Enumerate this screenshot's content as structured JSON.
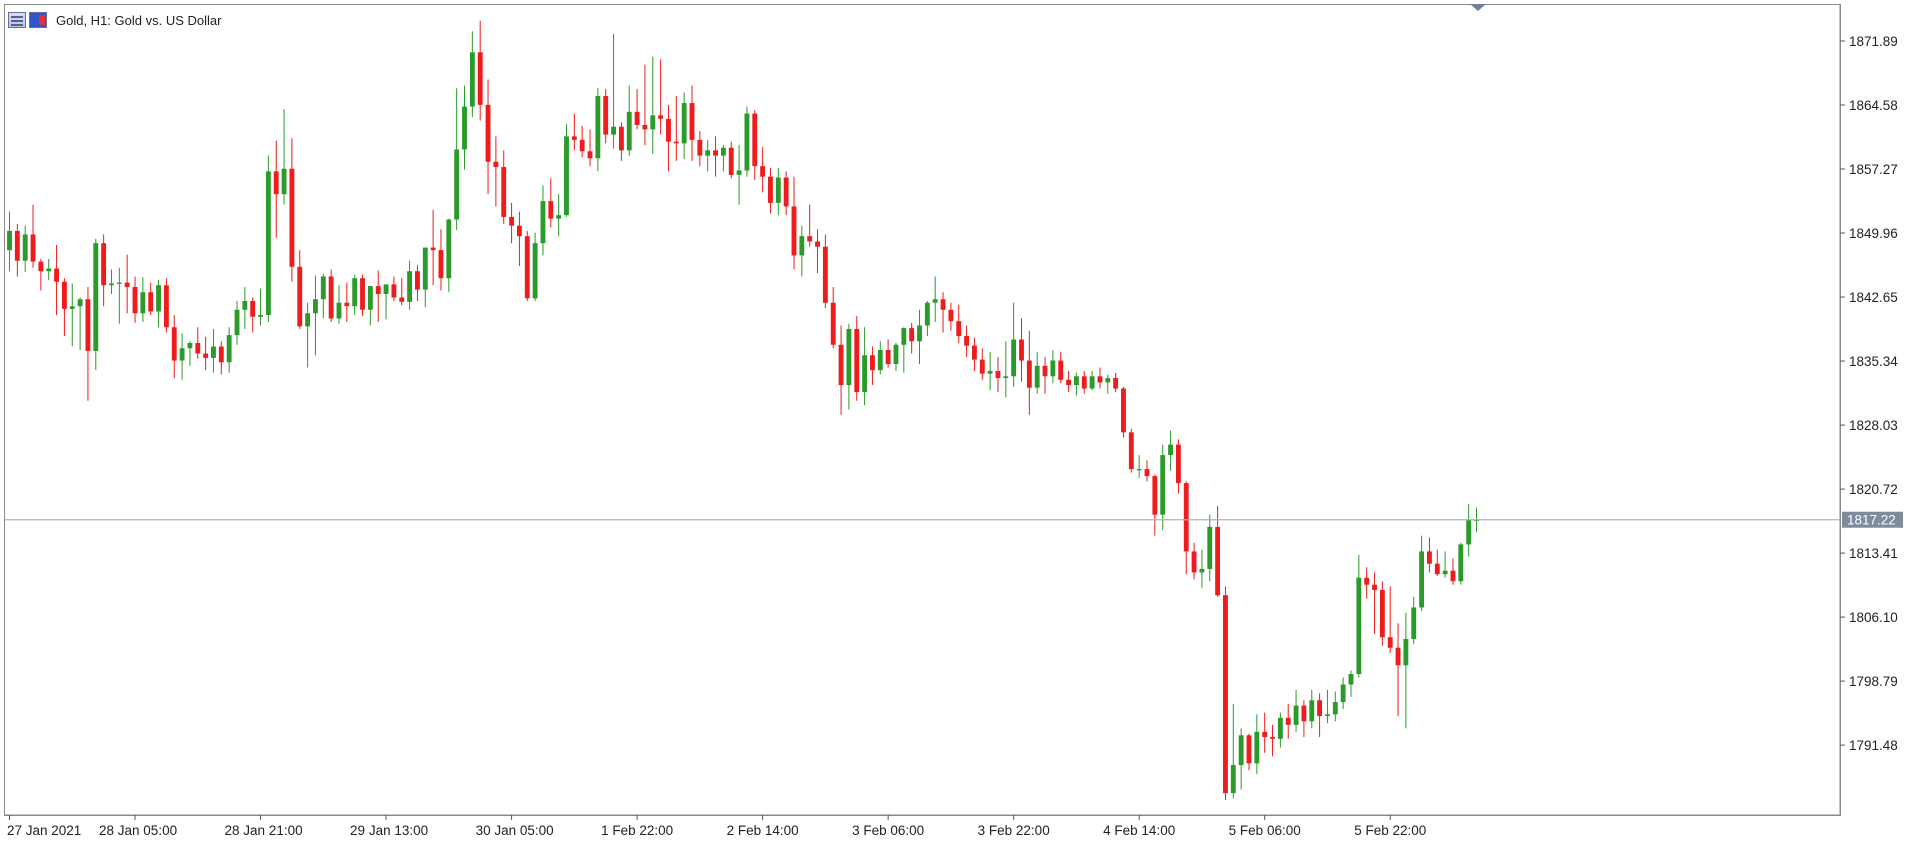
{
  "window": {
    "title": "Gold, H1:  Gold vs. US Dollar"
  },
  "icons": {
    "left": "chart-window-icon",
    "right": "indicator-icon"
  },
  "colors": {
    "bull": "#2a9a2a",
    "bear": "#ee1c1c",
    "wick_bull": "#2a9a2a",
    "wick_bear": "#ee1c1c",
    "grid_bid_line": "#a7b4c3",
    "bid_label_bg": "#7d8b9b",
    "bid_label_text": "#ffffff"
  },
  "chart_data": {
    "type": "candlestick",
    "symbol": "Gold",
    "timeframe": "H1",
    "title": "Gold, H1:  Gold vs. US Dollar",
    "y_ticks": [
      "1871.89",
      "1864.58",
      "1857.27",
      "1849.96",
      "1842.65",
      "1835.34",
      "1828.03",
      "1820.72",
      "1813.41",
      "1806.10",
      "1798.79",
      "1791.48"
    ],
    "x_ticks": [
      "27 Jan 2021",
      "28 Jan 05:00",
      "28 Jan 21:00",
      "29 Jan 13:00",
      "30 Jan 05:00",
      "1 Feb 22:00",
      "2 Feb 14:00",
      "3 Feb 06:00",
      "3 Feb 22:00",
      "4 Feb 14:00",
      "5 Feb 06:00",
      "5 Feb 22:00"
    ],
    "ylim": [
      1783.5,
      1876.0
    ],
    "current_price": "1817.22",
    "ohlc": [
      [
        1848.0,
        1852.4,
        1845.6,
        1850.2
      ],
      [
        1850.2,
        1851.0,
        1845.0,
        1846.8
      ],
      [
        1846.8,
        1850.8,
        1845.5,
        1849.8
      ],
      [
        1849.8,
        1853.2,
        1846.0,
        1846.7
      ],
      [
        1846.7,
        1847.0,
        1843.4,
        1845.6
      ],
      [
        1845.6,
        1847.0,
        1844.6,
        1845.9
      ],
      [
        1845.9,
        1848.6,
        1840.6,
        1844.4
      ],
      [
        1844.4,
        1844.8,
        1838.2,
        1841.3
      ],
      [
        1841.3,
        1844.2,
        1837.0,
        1841.6
      ],
      [
        1841.6,
        1842.6,
        1836.6,
        1842.4
      ],
      [
        1842.4,
        1843.8,
        1830.8,
        1836.5
      ],
      [
        1836.5,
        1849.3,
        1834.3,
        1848.8
      ],
      [
        1848.8,
        1849.8,
        1841.6,
        1844.0
      ],
      [
        1844.0,
        1845.8,
        1843.0,
        1844.2
      ],
      [
        1844.2,
        1846.0,
        1839.6,
        1844.3
      ],
      [
        1844.3,
        1847.5,
        1840.8,
        1843.8
      ],
      [
        1843.8,
        1845.0,
        1839.7,
        1840.8
      ],
      [
        1840.8,
        1844.9,
        1839.8,
        1843.2
      ],
      [
        1843.2,
        1844.3,
        1840.6,
        1841.0
      ],
      [
        1841.0,
        1844.6,
        1839.2,
        1844.0
      ],
      [
        1844.0,
        1844.8,
        1838.6,
        1839.2
      ],
      [
        1839.2,
        1840.6,
        1833.4,
        1835.4
      ],
      [
        1835.4,
        1838.5,
        1833.2,
        1836.8
      ],
      [
        1836.8,
        1837.6,
        1834.8,
        1837.4
      ],
      [
        1837.4,
        1839.2,
        1835.6,
        1836.2
      ],
      [
        1836.2,
        1838.1,
        1834.3,
        1835.7
      ],
      [
        1835.7,
        1839.0,
        1834.0,
        1837.0
      ],
      [
        1837.0,
        1837.6,
        1833.8,
        1835.2
      ],
      [
        1835.2,
        1839.2,
        1834.0,
        1838.3
      ],
      [
        1838.3,
        1842.2,
        1837.2,
        1841.2
      ],
      [
        1841.2,
        1843.8,
        1839.0,
        1842.2
      ],
      [
        1842.2,
        1842.6,
        1838.6,
        1840.4
      ],
      [
        1840.4,
        1843.6,
        1839.4,
        1840.6
      ],
      [
        1840.6,
        1858.8,
        1839.8,
        1857.0
      ],
      [
        1857.0,
        1860.5,
        1849.4,
        1854.4
      ],
      [
        1854.4,
        1864.1,
        1853.2,
        1857.3
      ],
      [
        1857.3,
        1860.8,
        1844.4,
        1846.1
      ],
      [
        1846.1,
        1848.0,
        1839.0,
        1839.3
      ],
      [
        1839.3,
        1842.0,
        1834.6,
        1840.8
      ],
      [
        1840.8,
        1845.1,
        1836.0,
        1842.4
      ],
      [
        1842.4,
        1845.3,
        1840.2,
        1845.0
      ],
      [
        1845.0,
        1845.8,
        1839.8,
        1840.2
      ],
      [
        1840.2,
        1844.0,
        1839.6,
        1842.0
      ],
      [
        1842.0,
        1844.3,
        1839.8,
        1841.6
      ],
      [
        1841.6,
        1845.2,
        1840.6,
        1844.8
      ],
      [
        1844.8,
        1845.2,
        1840.5,
        1841.2
      ],
      [
        1841.2,
        1843.4,
        1839.4,
        1843.9
      ],
      [
        1843.9,
        1845.7,
        1839.8,
        1843.0
      ],
      [
        1843.0,
        1844.0,
        1840.1,
        1844.1
      ],
      [
        1844.1,
        1845.0,
        1842.2,
        1842.6
      ],
      [
        1842.6,
        1844.8,
        1841.7,
        1842.1
      ],
      [
        1842.1,
        1846.8,
        1841.2,
        1845.6
      ],
      [
        1845.6,
        1846.3,
        1842.2,
        1843.5
      ],
      [
        1843.5,
        1848.3,
        1841.5,
        1848.3
      ],
      [
        1848.3,
        1852.6,
        1844.0,
        1848.0
      ],
      [
        1848.0,
        1850.4,
        1843.4,
        1844.8
      ],
      [
        1844.8,
        1851.6,
        1843.2,
        1851.5
      ],
      [
        1851.5,
        1866.5,
        1850.3,
        1859.5
      ],
      [
        1859.5,
        1866.8,
        1857.2,
        1864.4
      ],
      [
        1864.4,
        1873.0,
        1863.2,
        1870.6
      ],
      [
        1870.6,
        1874.2,
        1862.8,
        1864.6
      ],
      [
        1864.6,
        1867.5,
        1854.4,
        1858.1
      ],
      [
        1858.1,
        1861.0,
        1853.0,
        1857.5
      ],
      [
        1857.5,
        1859.4,
        1851.0,
        1851.8
      ],
      [
        1851.8,
        1853.4,
        1848.8,
        1850.8
      ],
      [
        1850.8,
        1852.4,
        1846.2,
        1849.6
      ],
      [
        1849.6,
        1850.2,
        1842.2,
        1842.5
      ],
      [
        1842.5,
        1850.0,
        1842.2,
        1848.8
      ],
      [
        1848.8,
        1855.4,
        1847.4,
        1853.6
      ],
      [
        1853.6,
        1856.2,
        1850.6,
        1851.6
      ],
      [
        1851.6,
        1854.4,
        1849.6,
        1852.0
      ],
      [
        1852.0,
        1862.4,
        1851.8,
        1861.0
      ],
      [
        1861.0,
        1863.6,
        1859.4,
        1860.6
      ],
      [
        1860.6,
        1862.2,
        1858.6,
        1859.3
      ],
      [
        1859.3,
        1861.8,
        1857.6,
        1858.5
      ],
      [
        1858.5,
        1866.5,
        1857.0,
        1865.6
      ],
      [
        1865.6,
        1866.4,
        1860.2,
        1861.2
      ],
      [
        1861.2,
        1872.7,
        1859.6,
        1862.1
      ],
      [
        1862.1,
        1862.6,
        1858.2,
        1859.4
      ],
      [
        1859.4,
        1866.8,
        1858.8,
        1863.8
      ],
      [
        1863.8,
        1866.4,
        1861.8,
        1862.3
      ],
      [
        1862.3,
        1869.2,
        1860.0,
        1861.8
      ],
      [
        1861.8,
        1870.1,
        1859.0,
        1863.4
      ],
      [
        1863.4,
        1869.8,
        1861.2,
        1863.0
      ],
      [
        1863.0,
        1864.6,
        1857.0,
        1860.4
      ],
      [
        1860.4,
        1865.6,
        1858.2,
        1860.2
      ],
      [
        1860.2,
        1866.0,
        1858.4,
        1864.8
      ],
      [
        1864.8,
        1866.8,
        1858.2,
        1860.6
      ],
      [
        1860.6,
        1861.6,
        1857.6,
        1858.8
      ],
      [
        1858.8,
        1860.6,
        1857.0,
        1859.4
      ],
      [
        1859.4,
        1861.0,
        1856.4,
        1858.8
      ],
      [
        1858.8,
        1860.0,
        1857.0,
        1859.7
      ],
      [
        1859.7,
        1860.4,
        1856.2,
        1856.6
      ],
      [
        1856.6,
        1860.0,
        1853.2,
        1857.1
      ],
      [
        1857.1,
        1864.4,
        1856.4,
        1863.6
      ],
      [
        1863.6,
        1864.0,
        1856.0,
        1857.6
      ],
      [
        1857.6,
        1859.8,
        1854.6,
        1856.4
      ],
      [
        1856.4,
        1857.4,
        1852.2,
        1853.4
      ],
      [
        1853.4,
        1857.4,
        1852.0,
        1856.3
      ],
      [
        1856.3,
        1857.0,
        1852.0,
        1853.0
      ],
      [
        1853.0,
        1856.4,
        1845.8,
        1847.4
      ],
      [
        1847.4,
        1850.8,
        1845.0,
        1849.6
      ],
      [
        1849.6,
        1853.2,
        1848.4,
        1849.0
      ],
      [
        1849.0,
        1850.4,
        1845.4,
        1848.4
      ],
      [
        1848.4,
        1849.8,
        1841.4,
        1842.0
      ],
      [
        1842.0,
        1843.8,
        1836.8,
        1837.2
      ],
      [
        1837.2,
        1839.4,
        1829.2,
        1832.6
      ],
      [
        1832.6,
        1839.6,
        1829.8,
        1839.0
      ],
      [
        1839.0,
        1840.5,
        1830.8,
        1831.8
      ],
      [
        1831.8,
        1839.2,
        1830.3,
        1836.0
      ],
      [
        1836.0,
        1837.0,
        1832.6,
        1834.3
      ],
      [
        1834.3,
        1837.6,
        1833.8,
        1836.6
      ],
      [
        1836.6,
        1837.8,
        1834.6,
        1835.0
      ],
      [
        1835.0,
        1837.4,
        1834.2,
        1837.2
      ],
      [
        1837.2,
        1839.2,
        1834.0,
        1839.1
      ],
      [
        1839.1,
        1839.7,
        1836.2,
        1837.6
      ],
      [
        1837.6,
        1841.2,
        1835.0,
        1839.4
      ],
      [
        1839.4,
        1842.2,
        1838.2,
        1842.0
      ],
      [
        1842.0,
        1845.0,
        1839.8,
        1842.4
      ],
      [
        1842.4,
        1843.2,
        1838.6,
        1841.2
      ],
      [
        1841.2,
        1842.0,
        1838.8,
        1839.9
      ],
      [
        1839.9,
        1841.8,
        1837.4,
        1838.2
      ],
      [
        1838.2,
        1839.4,
        1835.8,
        1837.1
      ],
      [
        1837.1,
        1838.0,
        1834.2,
        1835.5
      ],
      [
        1835.5,
        1836.8,
        1833.2,
        1833.9
      ],
      [
        1833.9,
        1836.4,
        1832.0,
        1834.2
      ],
      [
        1834.2,
        1835.8,
        1831.8,
        1833.4
      ],
      [
        1833.4,
        1837.6,
        1831.2,
        1833.6
      ],
      [
        1833.6,
        1842.0,
        1832.4,
        1837.8
      ],
      [
        1837.8,
        1840.2,
        1833.0,
        1835.4
      ],
      [
        1835.4,
        1838.8,
        1829.2,
        1832.3
      ],
      [
        1832.3,
        1836.4,
        1831.6,
        1834.8
      ],
      [
        1834.8,
        1835.8,
        1831.6,
        1833.6
      ],
      [
        1833.6,
        1836.6,
        1832.8,
        1835.4
      ],
      [
        1835.4,
        1836.4,
        1832.8,
        1833.2
      ],
      [
        1833.2,
        1834.2,
        1831.8,
        1832.6
      ],
      [
        1832.6,
        1834.0,
        1831.4,
        1833.6
      ],
      [
        1833.6,
        1834.2,
        1831.6,
        1832.2
      ],
      [
        1832.2,
        1834.2,
        1832.0,
        1833.6
      ],
      [
        1833.6,
        1834.6,
        1832.2,
        1832.9
      ],
      [
        1832.9,
        1833.8,
        1831.6,
        1833.4
      ],
      [
        1833.4,
        1834.0,
        1831.8,
        1832.2
      ],
      [
        1832.2,
        1832.4,
        1826.6,
        1827.2
      ],
      [
        1827.2,
        1827.6,
        1822.6,
        1823.0
      ],
      [
        1823.0,
        1824.6,
        1822.0,
        1823.0
      ],
      [
        1823.0,
        1824.0,
        1821.6,
        1822.2
      ],
      [
        1822.2,
        1822.4,
        1815.4,
        1817.8
      ],
      [
        1817.8,
        1825.8,
        1816.0,
        1824.6
      ],
      [
        1824.6,
        1827.4,
        1822.8,
        1825.8
      ],
      [
        1825.8,
        1826.4,
        1820.2,
        1821.4
      ],
      [
        1821.4,
        1821.6,
        1811.0,
        1813.6
      ],
      [
        1813.6,
        1814.6,
        1810.4,
        1811.2
      ],
      [
        1811.2,
        1813.8,
        1809.4,
        1811.6
      ],
      [
        1811.6,
        1817.8,
        1810.2,
        1816.4
      ],
      [
        1816.4,
        1818.8,
        1808.4,
        1808.6
      ],
      [
        1808.6,
        1809.6,
        1785.2,
        1786.0
      ],
      [
        1786.0,
        1796.2,
        1785.4,
        1789.2
      ],
      [
        1789.2,
        1793.4,
        1786.4,
        1792.6
      ],
      [
        1792.6,
        1792.8,
        1788.6,
        1789.4
      ],
      [
        1789.4,
        1795.0,
        1788.2,
        1793.0
      ],
      [
        1793.0,
        1795.2,
        1790.6,
        1792.4
      ],
      [
        1792.4,
        1793.8,
        1790.2,
        1792.2
      ],
      [
        1792.2,
        1795.2,
        1791.2,
        1794.6
      ],
      [
        1794.6,
        1796.2,
        1792.2,
        1793.8
      ],
      [
        1793.8,
        1797.8,
        1793.0,
        1796.0
      ],
      [
        1796.0,
        1796.6,
        1792.4,
        1794.2
      ],
      [
        1794.2,
        1797.8,
        1793.4,
        1796.6
      ],
      [
        1796.6,
        1797.4,
        1792.4,
        1794.8
      ],
      [
        1794.8,
        1797.8,
        1794.0,
        1795.0
      ],
      [
        1795.0,
        1797.6,
        1794.2,
        1796.4
      ],
      [
        1796.4,
        1799.2,
        1795.6,
        1798.4
      ],
      [
        1798.4,
        1800.0,
        1797.0,
        1799.6
      ],
      [
        1799.6,
        1813.2,
        1799.2,
        1810.6
      ],
      [
        1810.6,
        1811.8,
        1808.2,
        1809.8
      ],
      [
        1809.8,
        1811.2,
        1804.2,
        1809.2
      ],
      [
        1809.2,
        1810.2,
        1802.8,
        1803.8
      ],
      [
        1803.8,
        1809.6,
        1802.0,
        1802.6
      ],
      [
        1802.6,
        1805.4,
        1794.8,
        1800.6
      ],
      [
        1800.6,
        1806.6,
        1793.4,
        1803.6
      ],
      [
        1803.6,
        1808.4,
        1803.0,
        1807.2
      ],
      [
        1807.2,
        1815.4,
        1806.8,
        1813.6
      ],
      [
        1813.6,
        1815.2,
        1811.2,
        1812.2
      ],
      [
        1812.2,
        1813.8,
        1810.8,
        1811.0
      ],
      [
        1811.0,
        1813.6,
        1810.6,
        1811.4
      ],
      [
        1811.4,
        1812.8,
        1809.8,
        1810.2
      ],
      [
        1810.2,
        1814.6,
        1809.8,
        1814.4
      ],
      [
        1814.4,
        1819.0,
        1813.0,
        1817.2
      ],
      [
        1817.2,
        1818.6,
        1815.8,
        1817.22
      ]
    ]
  }
}
